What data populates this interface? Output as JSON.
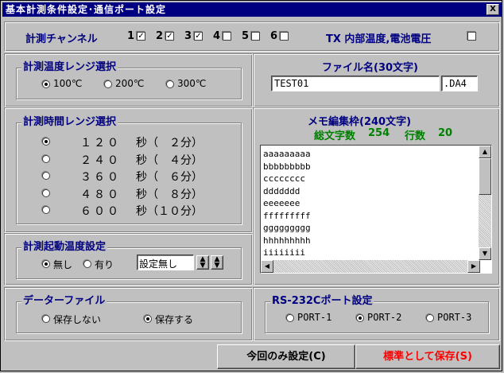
{
  "window": {
    "title": "基本計測条件設定･通信ポート設定",
    "close": "X"
  },
  "channels": {
    "label": "計測チャンネル",
    "items": [
      {
        "num": "1",
        "checked": true
      },
      {
        "num": "2",
        "checked": true
      },
      {
        "num": "3",
        "checked": true
      },
      {
        "num": "4",
        "checked": false
      },
      {
        "num": "5",
        "checked": false
      },
      {
        "num": "6",
        "checked": false
      }
    ],
    "tx_label": "TX 内部温度,電池電圧",
    "tx_checked": false
  },
  "temp_range": {
    "legend": "計測温度レンジ選択",
    "options": [
      "100℃",
      "200℃",
      "300℃"
    ],
    "selected": 0
  },
  "file": {
    "label": "ファイル名(30文字)",
    "name": "TEST01",
    "ext": ".DA4"
  },
  "time_range": {
    "legend": "計測時間レンジ選択",
    "options": [
      {
        "sec": "１２０",
        "unit": "秒",
        "min": "（　２分）"
      },
      {
        "sec": "２４０",
        "unit": "秒",
        "min": "（　４分）"
      },
      {
        "sec": "３６０",
        "unit": "秒",
        "min": "（　６分）"
      },
      {
        "sec": "４８０",
        "unit": "秒",
        "min": "（　８分）"
      },
      {
        "sec": "６００",
        "unit": "秒",
        "min": "（１０分）"
      }
    ],
    "selected": 0
  },
  "memo": {
    "label": "メモ編集枠(240文字)",
    "total_label": "総文字数",
    "total": "254",
    "lines_label": "行数",
    "lines_count": "20",
    "lines": [
      "aaaaaaaaa",
      "bbbbbbbbb",
      "cccccccc",
      "ddddddd",
      "eeeeeee",
      "fffffffff",
      "ggggggggg",
      "hhhhhhhhh",
      "iiiiiiii"
    ]
  },
  "start_temp": {
    "legend": "計測起動温度設定",
    "options": [
      "無し",
      "有り"
    ],
    "selected": 0,
    "value": "設定無し"
  },
  "data_file": {
    "legend": "データーファイル",
    "options": [
      "保存しない",
      "保存する"
    ],
    "selected": 1
  },
  "port": {
    "legend": "RS-232Cポート設定",
    "options": [
      "PORT-1",
      "PORT-2",
      "PORT-3"
    ],
    "selected": 1
  },
  "buttons": {
    "once": "今回のみ設定(C)",
    "default": "標準として保存(S)"
  },
  "colors": {
    "title_bar": "#000080",
    "label_blue": "#000080",
    "label_green": "#008000",
    "save_red": "#ff0000"
  }
}
